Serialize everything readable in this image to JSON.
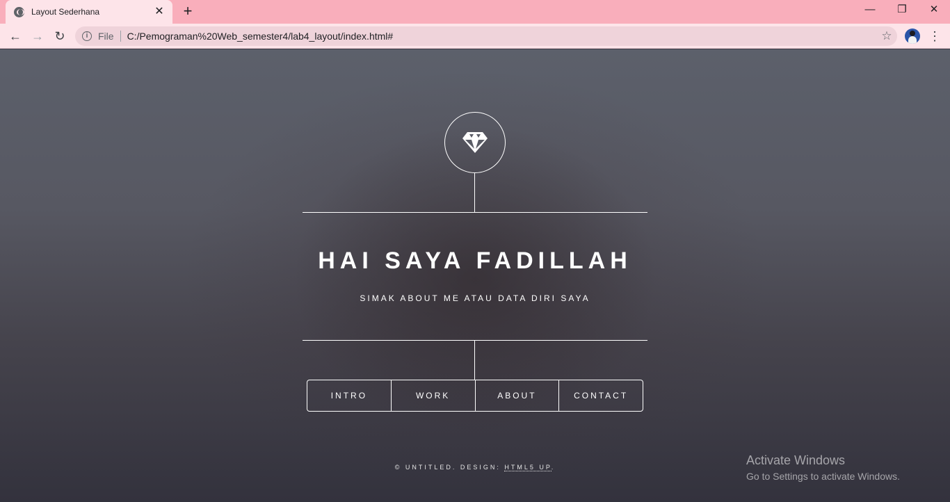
{
  "browser": {
    "tab_title": "Layout Sederhana",
    "tab_close": "✕",
    "new_tab": "+",
    "window_controls": {
      "minimize": "—",
      "restore": "❐",
      "close": "✕"
    },
    "nav": {
      "back": "←",
      "forward": "→",
      "reload": "↻"
    },
    "address": {
      "info": "i",
      "scheme": "File",
      "url": "C:/Pemograman%20Web_semester4/lab4_layout/index.html#",
      "bookmark": "☆"
    },
    "menu": "⋮"
  },
  "page": {
    "logo_icon": "diamond-icon",
    "headline": "HAI SAYA FADILLAH",
    "subheadline": "SIMAK ABOUT ME ATAU DATA DIRI SAYA",
    "nav_items": [
      {
        "label": "INTRO"
      },
      {
        "label": "WORK"
      },
      {
        "label": "ABOUT"
      },
      {
        "label": "CONTACT"
      }
    ],
    "footer": {
      "copyright": "© UNTITLED. DESIGN:",
      "link": "HTML5 UP",
      "end": "."
    }
  },
  "watermark": {
    "line1": "Activate Windows",
    "line2": "Go to Settings to activate Windows."
  },
  "colors": {
    "titlebar": "#f9aebb",
    "toolbar": "#fde4e9",
    "text_on_page": "#ffffff"
  }
}
